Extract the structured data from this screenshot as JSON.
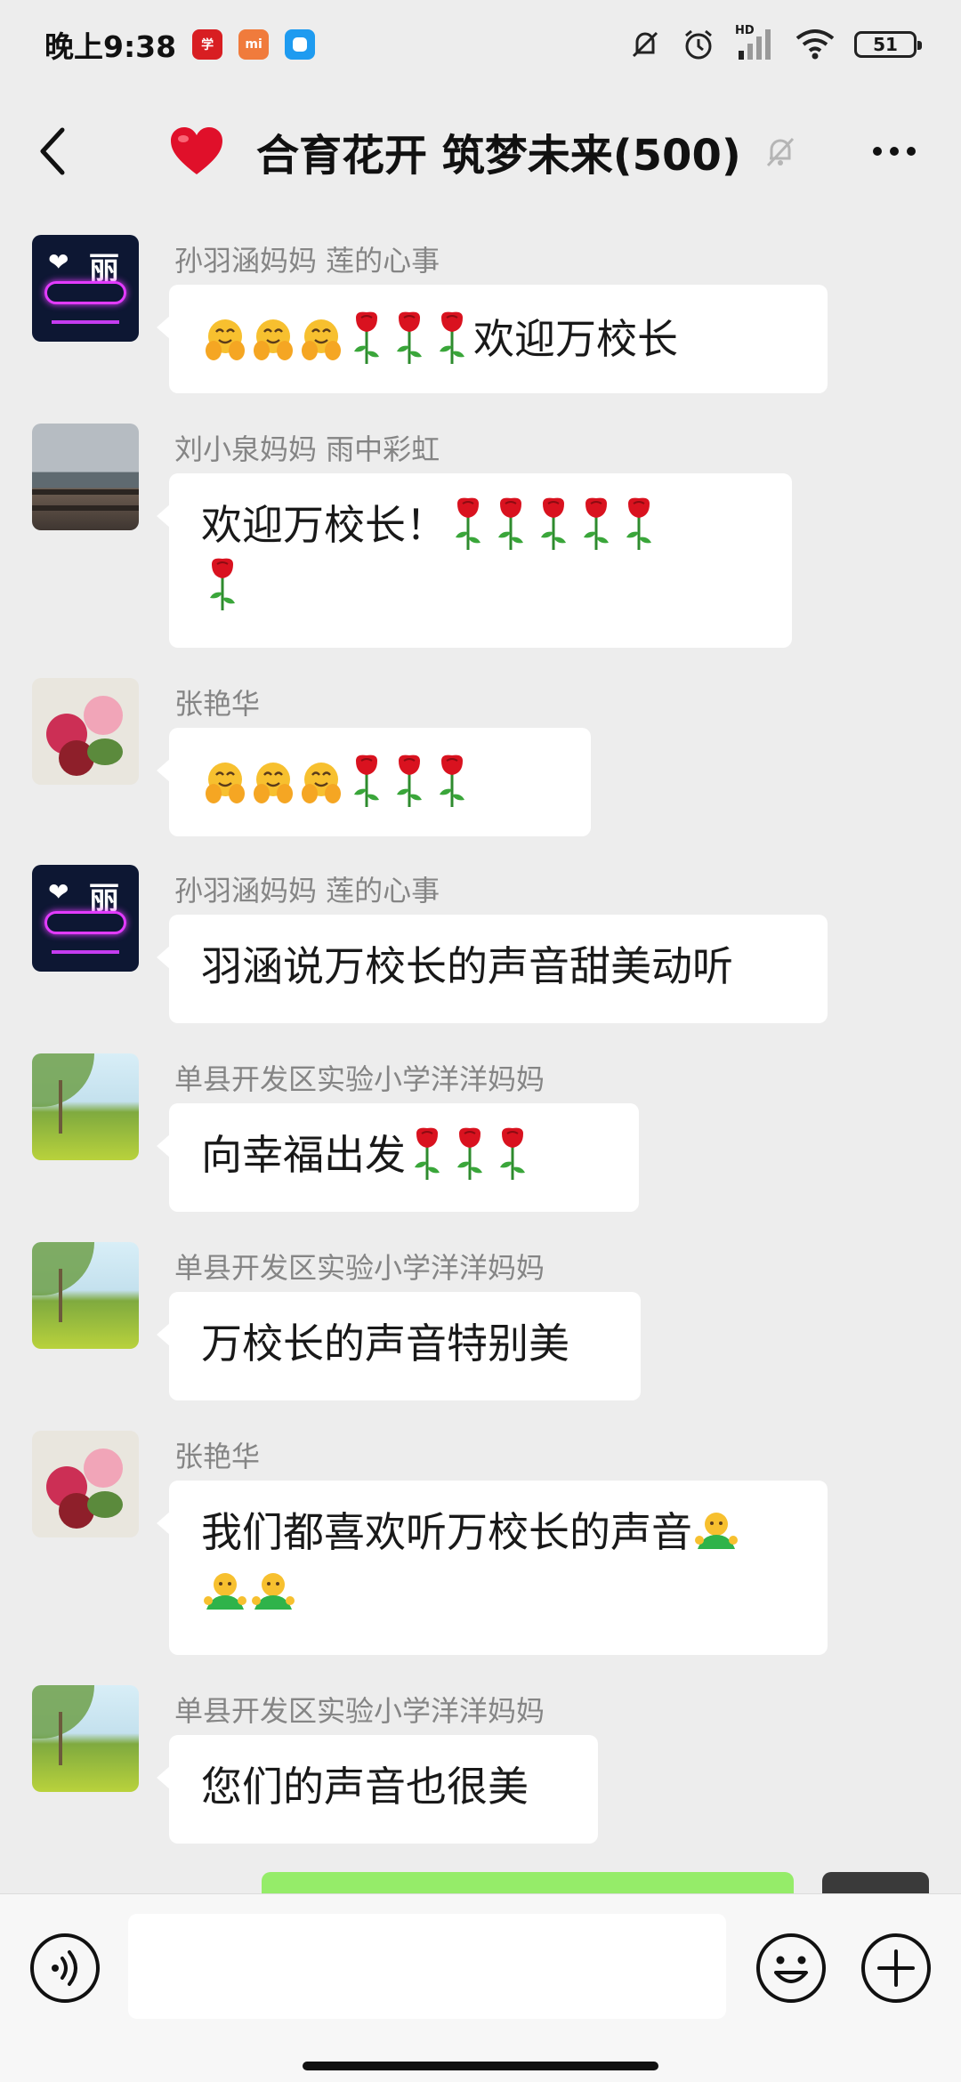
{
  "status": {
    "time": "晚上9:38",
    "app_icons": [
      "news-app-icon",
      "mi-app-icon",
      "chat-app-icon"
    ],
    "signal_label": "HD",
    "battery": "51"
  },
  "header": {
    "title": "合育花开 筑梦未来(500)",
    "icons": [
      "back-icon",
      "heart-icon",
      "mute-icon",
      "more-icon"
    ]
  },
  "messages": [
    {
      "sender": "孙羽涵妈妈  莲的心事",
      "avatar": "neon-avatar",
      "text": "欢迎万校长",
      "emoji_before": [
        "hugging-face",
        "hugging-face",
        "hugging-face",
        "rose",
        "rose",
        "rose"
      ]
    },
    {
      "sender": "刘小泉妈妈  雨中彩虹",
      "avatar": "lake-avatar",
      "text": "欢迎万校长！",
      "emoji_after": [
        "rose",
        "rose",
        "rose",
        "rose",
        "rose",
        "rose"
      ]
    },
    {
      "sender": "张艳华",
      "avatar": "flower-avatar",
      "text": "",
      "emoji_before": [
        "hugging-face",
        "hugging-face",
        "hugging-face",
        "rose",
        "rose",
        "rose"
      ]
    },
    {
      "sender": "孙羽涵妈妈  莲的心事",
      "avatar": "neon-avatar",
      "text": "羽涵说万校长的声音甜美动听"
    },
    {
      "sender": "单县开发区实验小学洋洋妈妈",
      "avatar": "field-avatar",
      "text": "向幸福出发",
      "emoji_after": [
        "rose",
        "rose",
        "rose"
      ]
    },
    {
      "sender": "单县开发区实验小学洋洋妈妈",
      "avatar": "field-avatar",
      "text": "万校长的声音特别美"
    },
    {
      "sender": "张艳华",
      "avatar": "flower-avatar",
      "text": "我们都喜欢听万校长的声音",
      "emoji_after": [
        "person-shrugging",
        "person-shrugging",
        "person-shrugging"
      ]
    },
    {
      "sender": "单县开发区实验小学洋洋妈妈",
      "avatar": "field-avatar",
      "text": "您们的声音也很美"
    }
  ],
  "input_bar": {
    "value": "",
    "icons": [
      "voice-icon",
      "emoji-icon",
      "plus-icon"
    ]
  },
  "colors": {
    "background": "#ededed",
    "bubble": "#ffffff",
    "outgoing_bubble": "#95ec69",
    "sender": "#858585"
  }
}
